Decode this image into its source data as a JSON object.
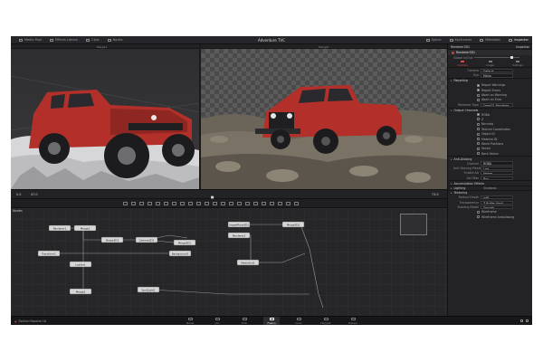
{
  "app": {
    "window_title": "Adventure TVC",
    "brand": "DaVinci Resolve 16"
  },
  "topbar": {
    "left": [
      {
        "label": "Media Pool",
        "icon": "media-pool-icon"
      },
      {
        "label": "Effects Library",
        "icon": "effects-library-icon"
      },
      {
        "label": "Clips",
        "icon": "clips-icon"
      },
      {
        "label": "Nodes",
        "icon": "nodes-icon"
      }
    ],
    "right": [
      {
        "label": "Spline",
        "icon": "spline-icon"
      },
      {
        "label": "Keyframes",
        "icon": "keyframes-icon"
      },
      {
        "label": "Metadata",
        "icon": "metadata-icon"
      },
      {
        "label": "Inspector",
        "icon": "inspector-icon"
      }
    ]
  },
  "viewers": {
    "left_name": "Merge1",
    "right_name": "Merge2"
  },
  "timebar": {
    "start": "0.0",
    "current": "47.0",
    "end": "73.0"
  },
  "nodes_panel": {
    "label": "Nodes",
    "nodes": [
      "Renderer1",
      "Merge1",
      "Shape3D1",
      "Camera3D1",
      "Merge3D1",
      "Transform1",
      "Background1",
      "Loader1",
      "Merge2",
      "SpotLight1",
      "ImagePlane3D1",
      "Renderer2",
      "Merge3D2",
      "MediaOut1"
    ]
  },
  "inspector": {
    "header_left": "Renderer3D1",
    "header_right": "Inspector",
    "node_name": "Renderer3D1",
    "global_in_out_label": "Global In/Out",
    "tabs": [
      {
        "label": "Controls",
        "icon": "controls-icon",
        "active": true
      },
      {
        "label": "Image",
        "icon": "image-icon",
        "active": false
      },
      {
        "label": "Settings",
        "icon": "settings-icon",
        "active": false
      }
    ],
    "camera": {
      "label": "Camera",
      "value": "Default"
    },
    "eye": {
      "label": "Eye",
      "value": "Mono"
    },
    "reporting_section": "Reporting",
    "reporting": [
      {
        "label": "Report Warnings",
        "checked": true
      },
      {
        "label": "Report Errors",
        "checked": true
      },
      {
        "label": "Abort on Warning",
        "checked": false
      },
      {
        "label": "Abort on Error",
        "checked": false
      }
    ],
    "renderer_type": {
      "label": "Renderer Type",
      "value": "OpenGL Renderer"
    },
    "output_channels_section": "Output Channels",
    "output_channels": [
      "RGBA",
      "Z",
      "Normals",
      "Texture Coordinates",
      "Object ID",
      "Material ID",
      "World Positions",
      "Vector",
      "Back Vector"
    ],
    "anti_aliasing_section": "Anti-Aliasing",
    "aa_rows": [
      {
        "label": "Channel",
        "value": "RGBA"
      },
      {
        "label": "Anti Aliasing Preset",
        "value": "Low"
      },
      {
        "label": "Enable AA",
        "value": "Vertex"
      },
      {
        "label": "AA Filter",
        "value": "Box"
      }
    ],
    "accumulation_section": "Accumulation Effects",
    "lighting_section": "Lighting",
    "lighting_value": "Shadows",
    "texturing_section": "Texturing",
    "texture_depth": {
      "label": "Texture Depth",
      "value": "int8"
    },
    "transparency": {
      "label": "Transparency",
      "value": "Z Buffer (fast)"
    },
    "shading_model": {
      "label": "Shading Model",
      "value": "Smooth"
    },
    "wireframe_rows": [
      "Wireframe",
      "Wireframe Antialiasing"
    ]
  },
  "bottom_pages": [
    {
      "label": "Media",
      "icon": "media-page-icon",
      "active": false
    },
    {
      "label": "Cut",
      "icon": "cut-page-icon",
      "active": false
    },
    {
      "label": "Edit",
      "icon": "edit-page-icon",
      "active": false
    },
    {
      "label": "Fusion",
      "icon": "fusion-page-icon",
      "active": true
    },
    {
      "label": "Color",
      "icon": "color-page-icon",
      "active": false
    },
    {
      "label": "Fairlight",
      "icon": "fairlight-page-icon",
      "active": false
    },
    {
      "label": "Deliver",
      "icon": "deliver-page-icon",
      "active": false
    }
  ],
  "colors": {
    "accent": "#e04b3f",
    "panel": "#232326",
    "background": "#1b1b1d",
    "truck_red": "#b3302a"
  }
}
